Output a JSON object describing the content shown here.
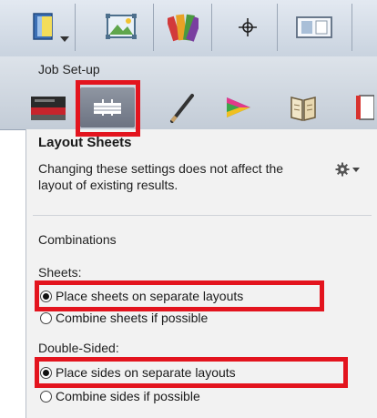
{
  "top_toolbar": {
    "buttons": [
      {
        "icon": "document-panel-icon",
        "has_dropdown": true
      },
      {
        "icon": "image-frame-icon"
      },
      {
        "icon": "color-swatches-icon"
      },
      {
        "icon": "crosshair-icon"
      },
      {
        "icon": "layout-preview-icon"
      }
    ]
  },
  "job_setup": {
    "label": "Job Set-up",
    "tools": [
      {
        "icon": "printer-icon"
      },
      {
        "icon": "layout-sheets-icon",
        "active": true
      },
      {
        "icon": "pen-icon"
      },
      {
        "icon": "color-wheel-icon"
      },
      {
        "icon": "book-icon"
      },
      {
        "icon": "report-icon"
      }
    ]
  },
  "panel": {
    "title": "Layout Sheets",
    "description": "Changing these settings does not affect the layout of existing results.",
    "gear_icon": "gear-icon",
    "combinations_label": "Combinations",
    "sheets": {
      "label": "Sheets:",
      "options": [
        "Place sheets on separate layouts",
        "Combine sheets if possible"
      ],
      "selected": 0
    },
    "double_sided": {
      "label": "Double-Sided:",
      "options": [
        "Place sides on separate layouts",
        "Combine sides if possible"
      ],
      "selected": 0
    }
  },
  "colors": {
    "highlight": "#e3141e",
    "toolbar": "#d2dae4",
    "panel": "#f2f2f2"
  }
}
